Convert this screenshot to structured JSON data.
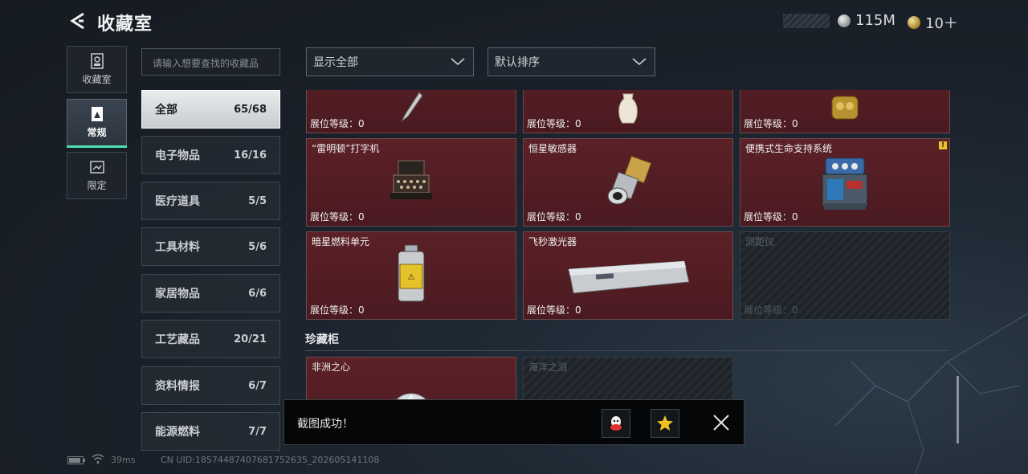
{
  "header": {
    "title": "收藏室",
    "silver": "115M",
    "gold": "10＋"
  },
  "nav": [
    {
      "label": "收藏室",
      "icon": "collection-room-icon"
    },
    {
      "label": "常规",
      "icon": "regular-icon"
    },
    {
      "label": "限定",
      "icon": "limited-icon"
    }
  ],
  "search": {
    "placeholder": "请输入想要查找的收藏品"
  },
  "categories": [
    {
      "label": "全部",
      "count": "65/68"
    },
    {
      "label": "电子物品",
      "count": "16/16"
    },
    {
      "label": "医疗道具",
      "count": "5/5"
    },
    {
      "label": "工具材料",
      "count": "5/6"
    },
    {
      "label": "家居物品",
      "count": "6/6"
    },
    {
      "label": "工艺藏品",
      "count": "20/21"
    },
    {
      "label": "资料情报",
      "count": "6/7"
    },
    {
      "label": "能源燃料",
      "count": "7/7"
    }
  ],
  "filters": {
    "show": "显示全部",
    "sort": "默认排序"
  },
  "items": [
    {
      "name": "",
      "level": "展位等级：0"
    },
    {
      "name": "",
      "level": "展位等级：0"
    },
    {
      "name": "",
      "level": "展位等级：0"
    },
    {
      "name": "“雷明顿”打字机",
      "level": "展位等级：0"
    },
    {
      "name": "恒星敏感器",
      "level": "展位等级：0"
    },
    {
      "name": "便携式生命支持系统",
      "level": "展位等级：0",
      "warn": "!"
    },
    {
      "name": "暗星燃料单元",
      "level": "展位等级：0"
    },
    {
      "name": "飞秒激光器",
      "level": "展位等级：0"
    },
    {
      "name": "测距仪",
      "level": "展位等级：0"
    }
  ],
  "section2": {
    "title": "珍藏柜",
    "items": [
      {
        "name": "非洲之心"
      },
      {
        "name": "海洋之泪"
      }
    ]
  },
  "toast": {
    "message": "截图成功！"
  },
  "status": {
    "ping": "39ms",
    "uid": "CN UID:18574487407681752635_202605141108"
  }
}
